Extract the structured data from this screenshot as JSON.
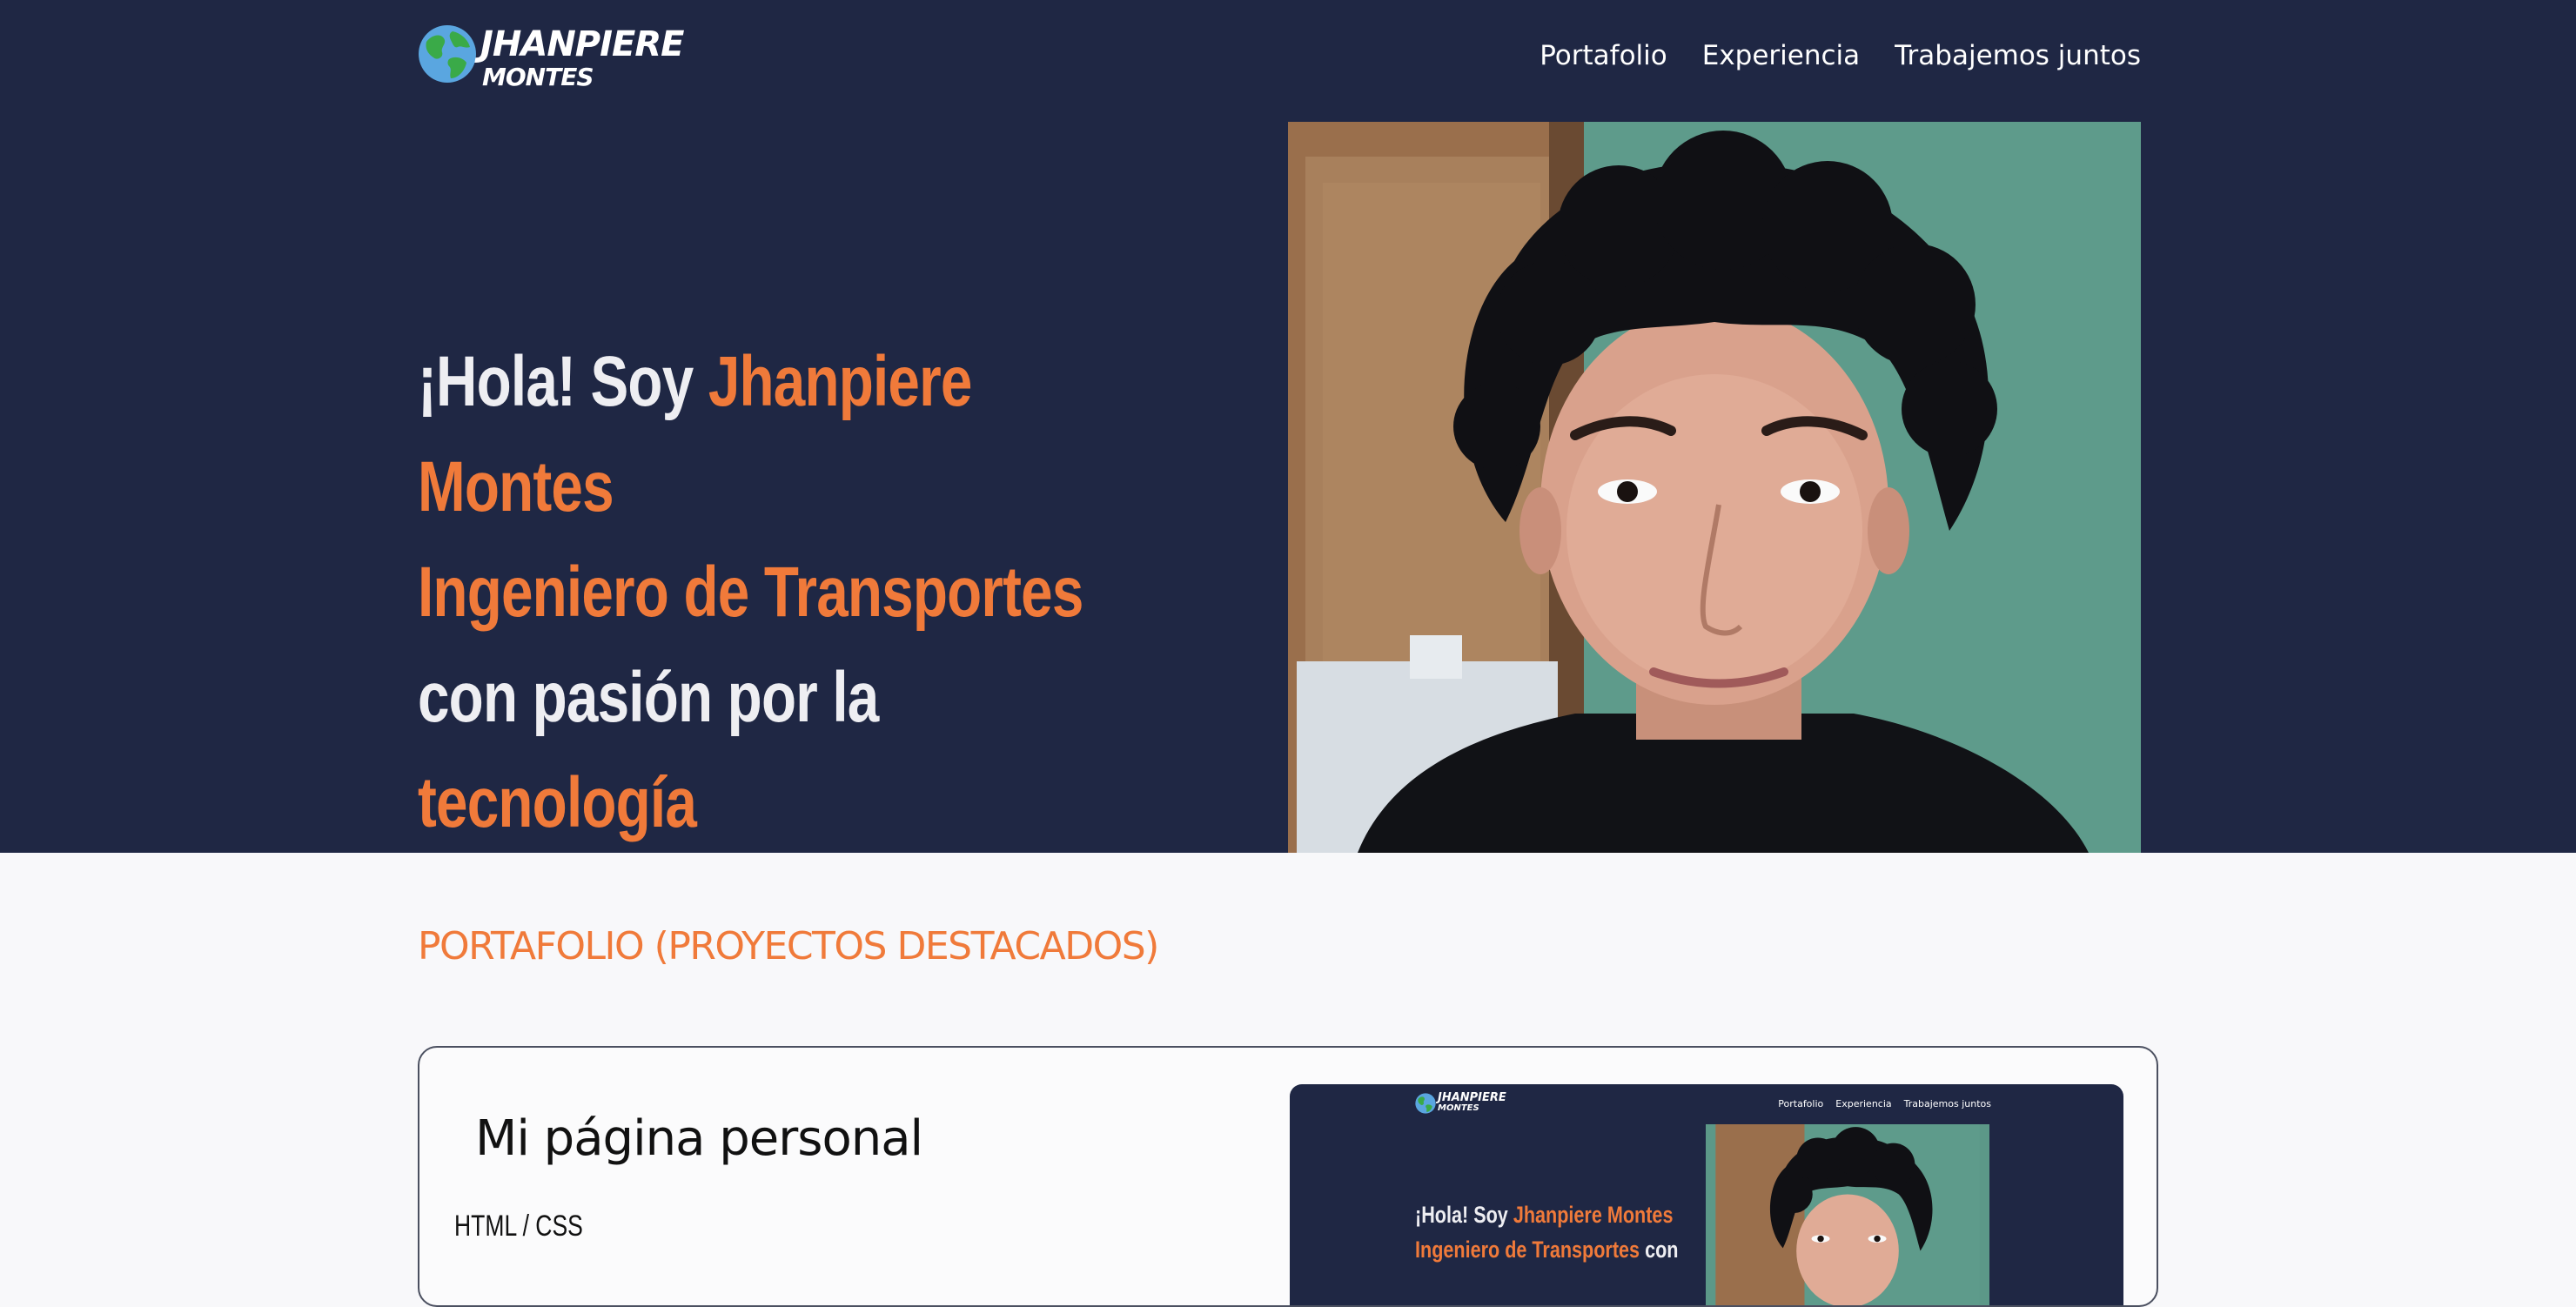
{
  "header": {
    "logo_line1": "JHANPIERE",
    "logo_line2": "MONTES",
    "nav": [
      {
        "label": "Portafolio"
      },
      {
        "label": "Experiencia"
      },
      {
        "label": "Trabajemos juntos"
      }
    ]
  },
  "hero": {
    "greeting": "¡Hola! Soy ",
    "name": "Jhanpiere Montes",
    "profession": "Ingeniero de Transportes",
    "connector": " con pasión por la ",
    "interest": "tecnología"
  },
  "portfolio": {
    "section_title": "PORTAFOLIO (PROYECTOS DESTACADOS)",
    "projects": [
      {
        "title": "Mi página personal",
        "tech": "HTML / CSS",
        "preview": {
          "logo_line1": "JHANPIERE",
          "logo_line2": "MONTES",
          "nav": [
            "Portafolio",
            "Experiencia",
            "Trabajemos juntos"
          ],
          "greeting": "¡Hola! Soy ",
          "name": "Jhanpiere Montes",
          "profession": "Ingeniero de Transportes",
          "connector": " con"
        }
      }
    ]
  },
  "colors": {
    "navy": "#1f2744",
    "accent": "#f07a3a",
    "page_bg": "#f8f8fa"
  },
  "icons": {
    "logo": "globe-icon"
  }
}
